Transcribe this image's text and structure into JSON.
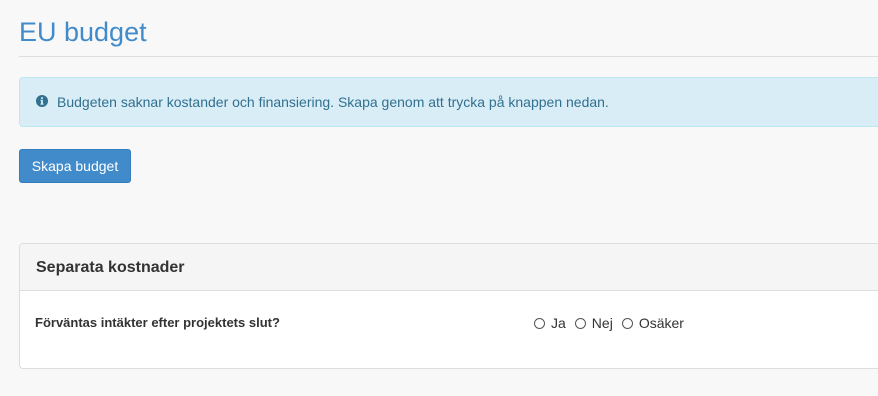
{
  "page": {
    "title": "EU budget"
  },
  "alert": {
    "icon": "info-circle-icon",
    "text": "Budgeten saknar kostander och finansiering. Skapa genom att trycka på knappen nedan.",
    "background": "#d9edf7",
    "text_color": "#31708f"
  },
  "actions": {
    "create_budget_label": "Skapa budget",
    "accent": "#428bca"
  },
  "panel": {
    "title": "Separata kostnader",
    "question": "Förväntas intäkter efter projektets slut?",
    "options": [
      {
        "label": "Ja",
        "selected": false
      },
      {
        "label": "Nej",
        "selected": false
      },
      {
        "label": "Osäker",
        "selected": false
      }
    ]
  }
}
